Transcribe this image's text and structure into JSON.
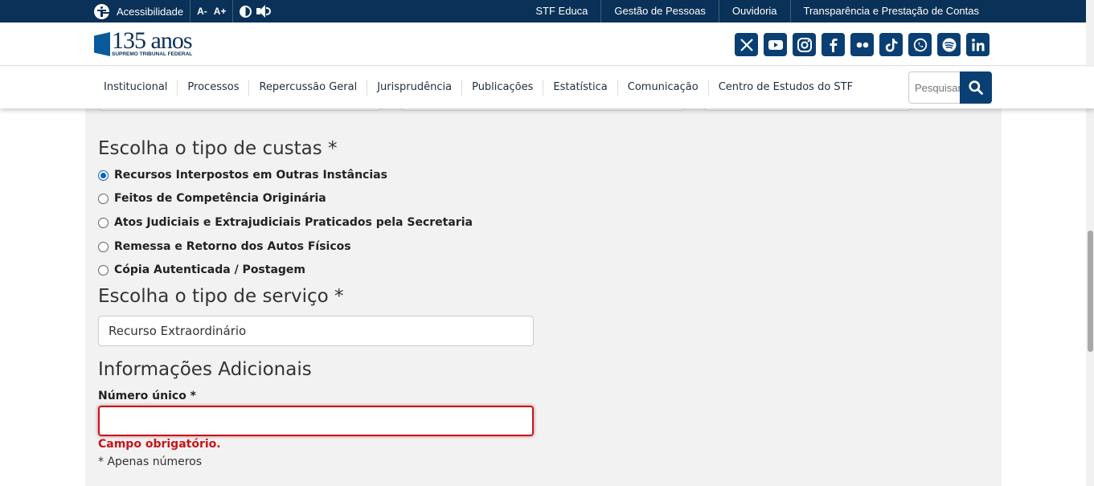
{
  "topbar": {
    "accessibility_label": "Acessibilidade",
    "font_decrease": "A-",
    "font_increase": "A+",
    "links": [
      "STF Educa",
      "Gestão de Pessoas",
      "Ouvidoria",
      "Transparência e Prestação de Contas"
    ]
  },
  "header": {
    "logo_number": "135 anos",
    "logo_subtitle": "SUPREMO TRIBUNAL FEDERAL",
    "socials": [
      "x-icon",
      "youtube-icon",
      "instagram-icon",
      "facebook-icon",
      "flickr-icon",
      "tiktok-icon",
      "whatsapp-icon",
      "spotify-icon",
      "linkedin-icon"
    ]
  },
  "nav": {
    "items": [
      "Institucional",
      "Processos",
      "Repercussão Geral",
      "Jurisprudência",
      "Publicações",
      "Estatística",
      "Comunicação",
      "Centro de Estudos do STF"
    ],
    "search_placeholder": "Pesquisar"
  },
  "form": {
    "custas_title": "Escolha o tipo de custas *",
    "custas_options": [
      {
        "label": "Recursos Interpostos em Outras Instâncias",
        "selected": true
      },
      {
        "label": "Feitos de Competência Originária",
        "selected": false
      },
      {
        "label": "Atos Judiciais e Extrajudiciais Praticados pela Secretaria",
        "selected": false
      },
      {
        "label": "Remessa e Retorno dos Autos Físicos",
        "selected": false
      },
      {
        "label": "Cópia Autenticada / Postagem",
        "selected": false
      }
    ],
    "servico_title": "Escolha o tipo de serviço *",
    "servico_value": "Recurso Extraordinário",
    "info_title": "Informações Adicionais",
    "numero_label": "Número único *",
    "numero_value": "",
    "error_text": "Campo obrigatório.",
    "hint_text": "* Apenas números"
  },
  "colors": {
    "topbar": "#0a3157",
    "brand": "#0a3f73",
    "error": "#c4161c",
    "content_bg": "#f2f2f2"
  }
}
